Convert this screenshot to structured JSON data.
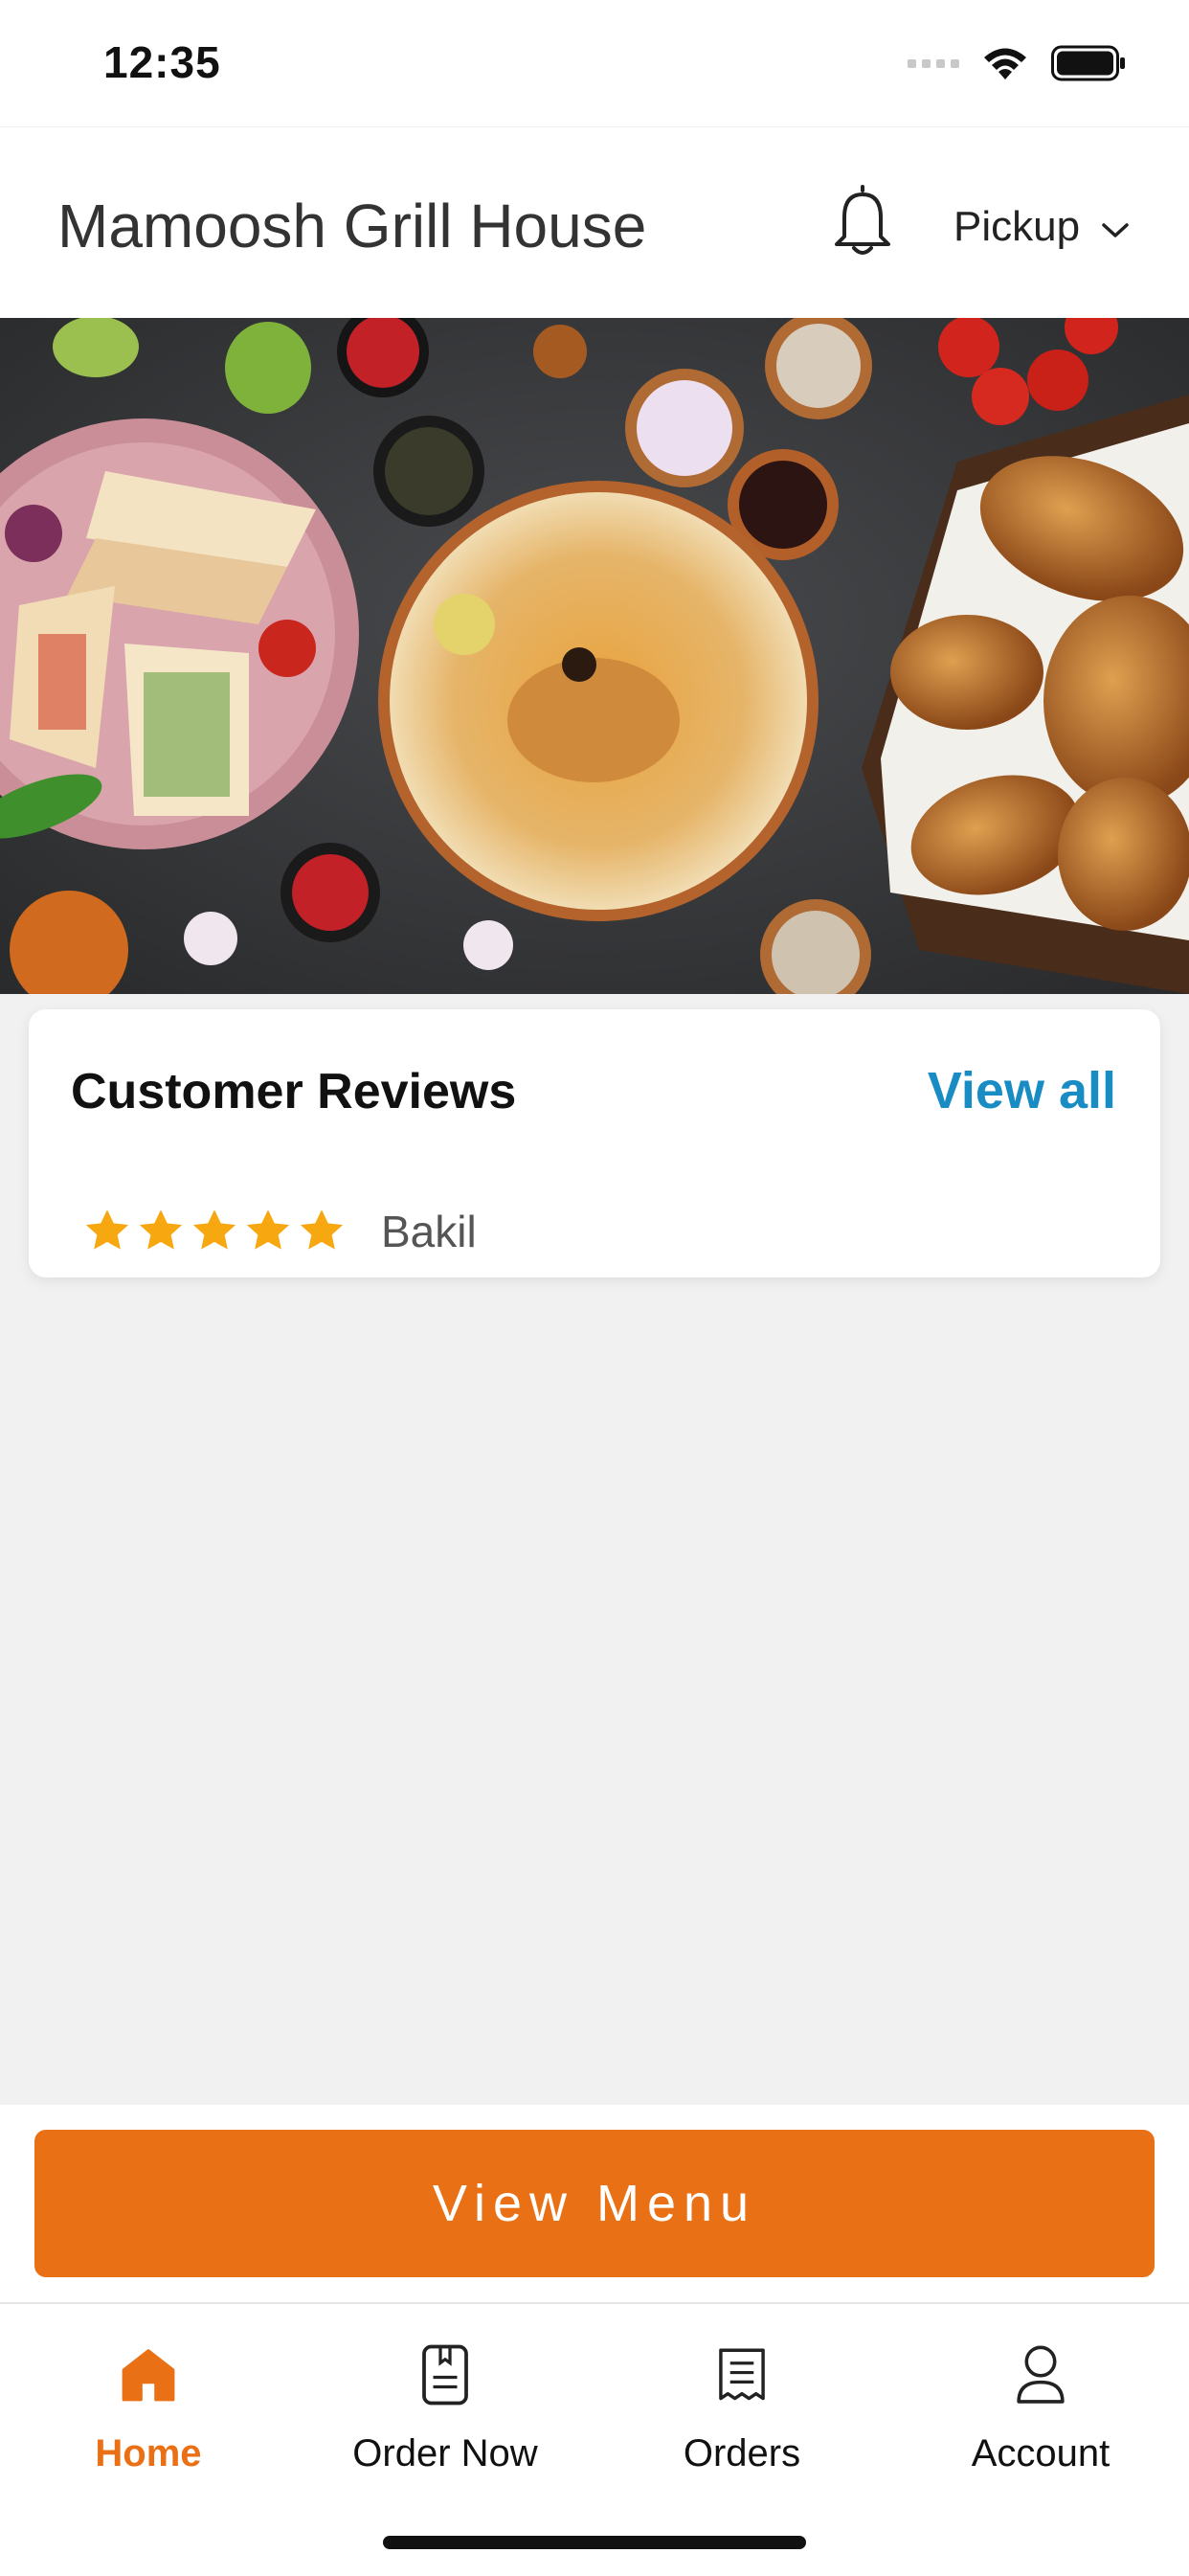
{
  "status_bar": {
    "time": "12:35"
  },
  "header": {
    "restaurant_name": "Mamoosh Grill House",
    "order_mode": "Pickup",
    "icons": [
      "bell-icon",
      "chevron-down-icon"
    ]
  },
  "hero": {
    "alt_icon": "food-banner-image"
  },
  "reviews": {
    "title": "Customer Reviews",
    "view_all_label": "View all",
    "items": [
      {
        "stars": 5,
        "reviewer": "Bakil"
      }
    ]
  },
  "cta": {
    "label": "View Menu"
  },
  "tabs": [
    {
      "label": "Home",
      "icon": "home-icon",
      "active": true
    },
    {
      "label": "Order Now",
      "icon": "order-icon",
      "active": false
    },
    {
      "label": "Orders",
      "icon": "receipt-icon",
      "active": false
    },
    {
      "label": "Account",
      "icon": "user-icon",
      "active": false
    }
  ],
  "colors": {
    "accent": "#ea7015",
    "link": "#1a8cc4",
    "star": "#f7a70f",
    "background": "#f1f1f1"
  }
}
